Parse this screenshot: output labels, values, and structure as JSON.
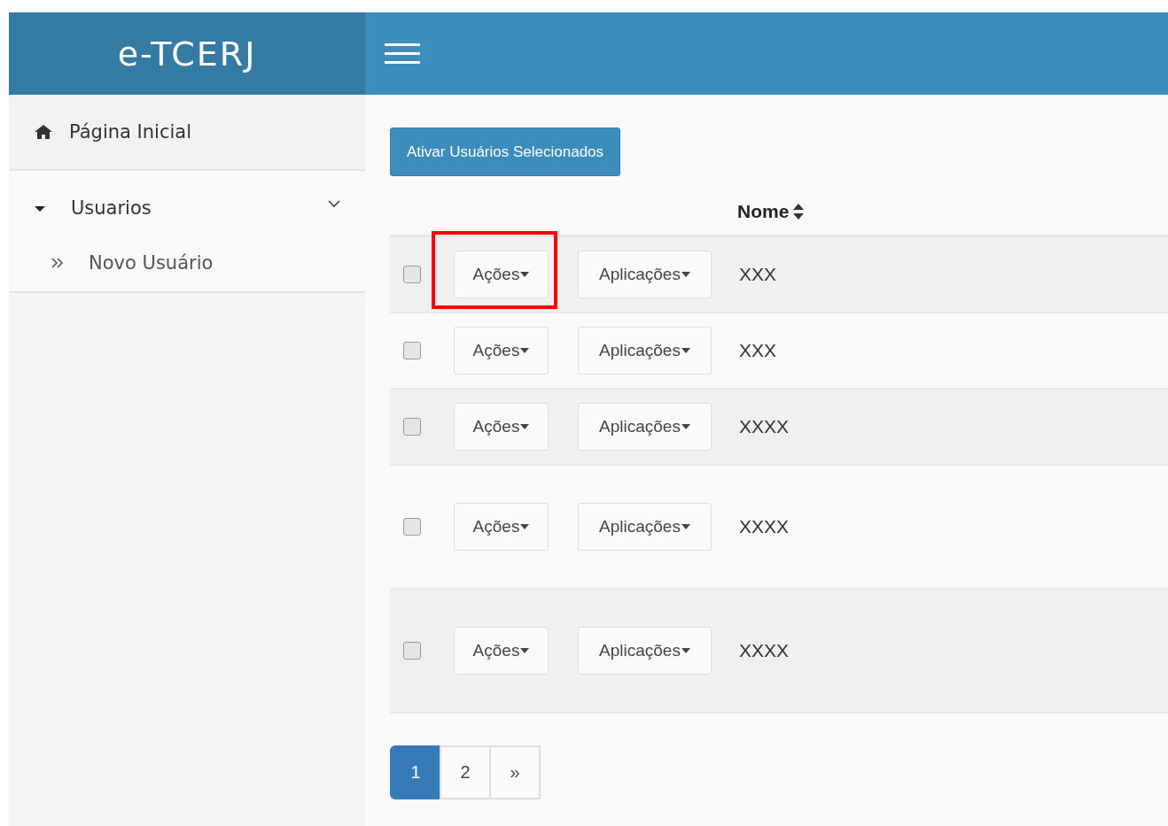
{
  "brand": "e-TCERJ",
  "sidebar": {
    "items": [
      {
        "label": "Página Inicial",
        "kind": "link"
      },
      {
        "label": "Usuarios",
        "kind": "group",
        "expanded": true,
        "children": [
          {
            "label": "Novo Usuário"
          }
        ]
      }
    ]
  },
  "activate_button": "Ativar Usuários Selecionados",
  "table": {
    "columns": [
      "Nome"
    ],
    "rows": [
      {
        "checked": false,
        "actions": "Ações",
        "apps": "Aplicações",
        "name": "XXX",
        "highlighted": true
      },
      {
        "checked": false,
        "actions": "Ações",
        "apps": "Aplicações",
        "name": "XXX",
        "highlighted": false
      },
      {
        "checked": false,
        "actions": "Ações",
        "apps": "Aplicações",
        "name": "XXXX",
        "highlighted": false
      },
      {
        "checked": false,
        "actions": "Ações",
        "apps": "Aplicações",
        "name": "XXXX",
        "highlighted": false
      },
      {
        "checked": false,
        "actions": "Ações",
        "apps": "Aplicações",
        "name": "XXXX",
        "highlighted": false
      }
    ]
  },
  "pagination": [
    {
      "label": "1",
      "selected": true
    },
    {
      "label": "2",
      "selected": false
    },
    {
      "label": "»",
      "selected": false
    }
  ]
}
